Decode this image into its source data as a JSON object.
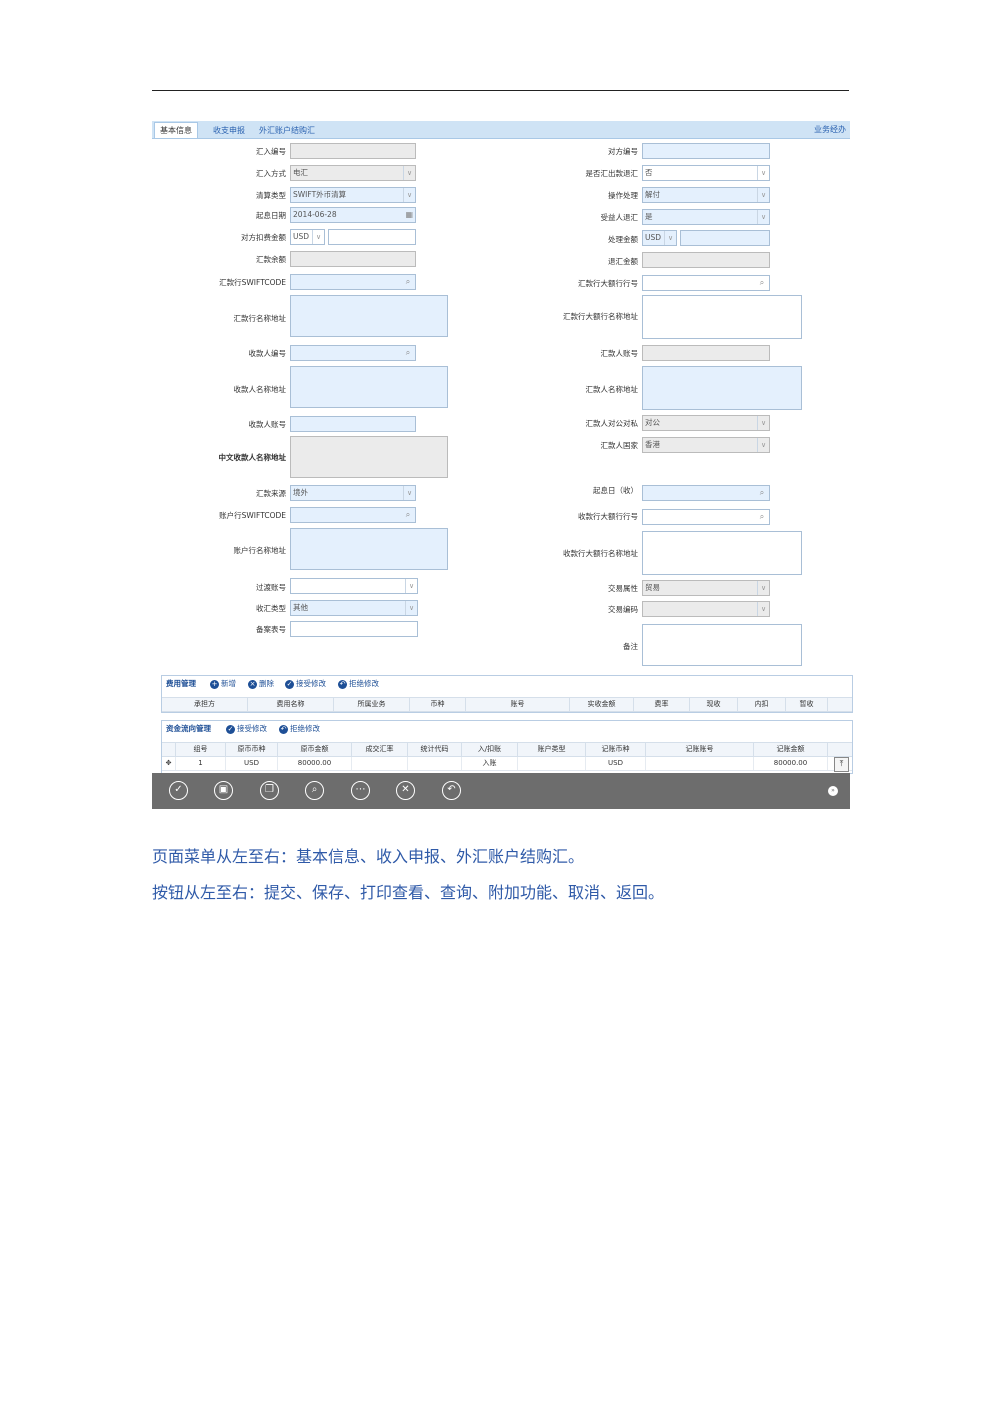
{
  "tabs": {
    "basic": "基本信息",
    "income": "收支申报",
    "fx": "外汇账户结购汇",
    "right": "业务经办"
  },
  "form": {
    "left": [
      {
        "label": "汇入编号",
        "value": ""
      },
      {
        "label": "汇入方式",
        "value": "电汇"
      },
      {
        "label": "清算类型",
        "value": "SWIFT外币清算"
      },
      {
        "label": "起息日期",
        "value": "2014-06-28"
      },
      {
        "label": "对方扣费金额",
        "value": "USD"
      },
      {
        "label": "汇款余额",
        "value": ""
      },
      {
        "label": "汇款行SWIFTCODE",
        "value": ""
      },
      {
        "label": "汇款行名称地址",
        "value": ""
      },
      {
        "label": "收款人编号",
        "value": ""
      },
      {
        "label": "收款人名称地址",
        "value": ""
      },
      {
        "label": "收款人账号",
        "value": ""
      },
      {
        "label": "中文收款人名称地址",
        "value": ""
      },
      {
        "label": "汇款来源",
        "value": "境外"
      },
      {
        "label": "账户行SWIFTCODE",
        "value": ""
      },
      {
        "label": "账户行名称地址",
        "value": ""
      },
      {
        "label": "过渡账号",
        "value": ""
      },
      {
        "label": "收汇类型",
        "value": "其他"
      },
      {
        "label": "备案表号",
        "value": ""
      }
    ],
    "right": [
      {
        "label": "对方编号",
        "value": ""
      },
      {
        "label": "是否汇出款退汇",
        "value": "否"
      },
      {
        "label": "操作处理",
        "value": "解付"
      },
      {
        "label": "受益人退汇",
        "value": "是"
      },
      {
        "label": "处理金额",
        "value": "USD"
      },
      {
        "label": "退汇金额",
        "value": ""
      },
      {
        "label": "汇款行大额行行号",
        "value": ""
      },
      {
        "label": "汇款行大额行名称地址",
        "value": ""
      },
      {
        "label": "汇款人账号",
        "value": ""
      },
      {
        "label": "汇款人名称地址",
        "value": ""
      },
      {
        "label": "汇款人对公对私",
        "value": "对公"
      },
      {
        "label": "汇款人国家",
        "value": "香港"
      },
      {
        "label": "起息日（收）",
        "value": ""
      },
      {
        "label": "收款行大额行行号",
        "value": ""
      },
      {
        "label": "收款行大额行名称地址",
        "value": ""
      },
      {
        "label": "交易属性",
        "value": "贸易"
      },
      {
        "label": "交易编码",
        "value": ""
      },
      {
        "label": "备注",
        "value": ""
      }
    ]
  },
  "fee_panel": {
    "title": "费用管理",
    "buttons": [
      "新增",
      "删除",
      "接受修改",
      "拒绝修改"
    ],
    "headers": [
      "承担方",
      "费用名称",
      "所属业务",
      "币种",
      "账号",
      "实收金额",
      "费率",
      "现收",
      "内扣",
      "暂收"
    ]
  },
  "fund_panel": {
    "title": "资金流向管理",
    "buttons": [
      "接受修改",
      "拒绝修改"
    ],
    "headers": [
      "组号",
      "原币币种",
      "原币金额",
      "成交汇率",
      "统计代码",
      "入/扣账",
      "账户类型",
      "记账币种",
      "记账账号",
      "记账金额"
    ],
    "rows": [
      {
        "no": "1",
        "cur": "USD",
        "amt": "80000.00",
        "rate": "",
        "code": "",
        "io": "入账",
        "acct_type": "",
        "book_cur": "USD",
        "book_acct": "",
        "book_amt": "80000.00"
      }
    ]
  },
  "notes": {
    "menu": "页面菜单从左至右：基本信息、收入申报、外汇账户结购汇。",
    "buttons": "按钮从左至右：提交、保存、打印查看、查询、附加功能、取消、返回。"
  }
}
